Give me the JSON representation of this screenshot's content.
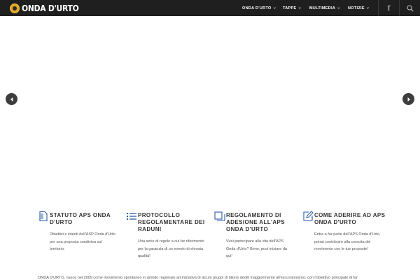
{
  "header": {
    "logo_text": "ONDA D'URTO",
    "menu": [
      {
        "label": "ONDA D'URTO"
      },
      {
        "label": "TAPPE"
      },
      {
        "label": "MULTIMEDIA"
      },
      {
        "label": "NOTIZIE"
      }
    ],
    "facebook_icon": "facebook-icon",
    "search_icon": "search-icon"
  },
  "slider": {
    "prev_icon": "chevron-left-icon",
    "next_icon": "chevron-right-icon"
  },
  "features": [
    {
      "icon": "document-icon",
      "title": "STATUTO APS ONDA D'URTO",
      "text": "Obiettivi e intenti dell'ASP Onda d'Urto per una proposta condivisa sul territorio."
    },
    {
      "icon": "list-icon",
      "title": "PROTOCOLLO REGOLAMENTARE DEI RADUNI",
      "text": "Una serie di regole a cui far riferimento per la garanzia di un evento di elevata qualità!"
    },
    {
      "icon": "copy-icon",
      "title": "REGOLAMENTO DI ADESIONE ALL'APS ONDA D'URTO",
      "text": "Vuoi partecipare alla vita dell'APS Onda d'Urto? Bene, puoi iniziare da qui!"
    },
    {
      "icon": "edit-icon",
      "title": "COME ADERIRE AD APS ONDA D'URTO",
      "text": "Entra a far parte dell'APS Onda d'Urto, potrai contribuire alla crescita del movimento con le tue proposte!"
    }
  ],
  "bottom_text": "ONDA D'URTO, nasce nel 2009 come movimento spontaneo in ambito regionale ad iniziativa di alcuni gruppi di bikers dediti maggiormente all'escursionismo, con l'obiettivo principale di far"
}
